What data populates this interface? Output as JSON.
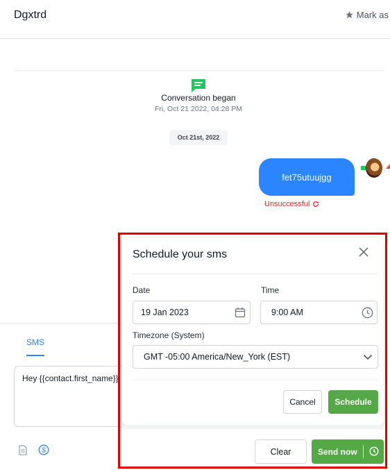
{
  "header": {
    "title": "Dgxtrd",
    "mark_as_label": "Mark as"
  },
  "conversation": {
    "began_title": "Conversation began",
    "began_date": "Fri, Oct 21 2022, 04:28 PM",
    "date_pill": "Oct 21st, 2022",
    "message_text": "fet75utuujgg",
    "message_status": "Unsuccessful"
  },
  "composer": {
    "tab_label": "SMS",
    "message_value": "Hey {{contact.first_name}}"
  },
  "modal": {
    "title": "Schedule your sms",
    "date_label": "Date",
    "date_value": "19 Jan 2023",
    "time_label": "Time",
    "time_value": "9:00 AM",
    "timezone_label": "Timezone (System)",
    "timezone_value": "GMT -05:00 America/New_York (EST)",
    "cancel_label": "Cancel",
    "schedule_label": "Schedule"
  },
  "footer": {
    "clear_label": "Clear",
    "send_now_label": "Send now"
  },
  "colors": {
    "accent_blue": "#2a85ff",
    "success_green": "#55a846",
    "error_red": "#dc2626",
    "highlight_red": "#e10000",
    "icon_green": "#22c55e"
  },
  "icons": [
    "star-icon",
    "chat-icon",
    "refresh-icon",
    "close-icon",
    "calendar-icon",
    "clock-icon",
    "chevron-down-icon",
    "document-icon",
    "dollar-icon"
  ]
}
